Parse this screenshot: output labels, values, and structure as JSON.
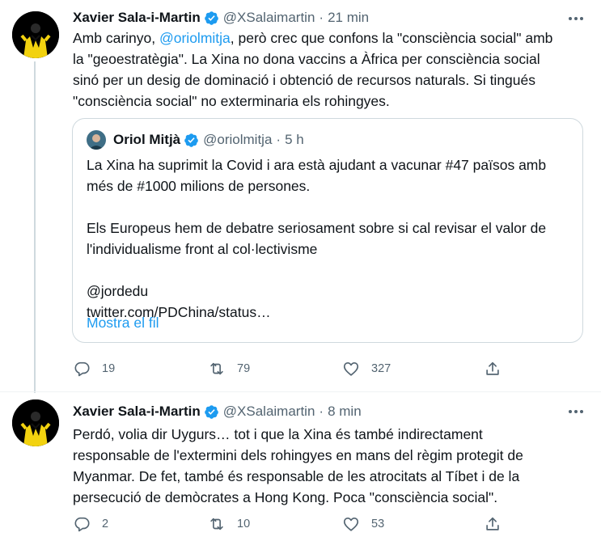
{
  "tweets": [
    {
      "author": {
        "name": "Xavier Sala-i-Martin",
        "handle": "@XSalaimartin",
        "time": "21 min"
      },
      "text_lines": [
        [
          "Amb carinyo, ",
          "@oriolmitja",
          ", però crec que confons la \"consciència social\" amb"
        ],
        "la \"geoestratègia\". La Xina no dona vaccins a Àfrica per consciència social",
        "sinó per un desig de dominació i obtenció de recursos naturals. Si tingués",
        "\"consciència social\" no exterminaria els rohingyes."
      ],
      "quote": {
        "author": {
          "name": "Oriol Mitjà",
          "handle": "@oriolmitja",
          "time": "5 h"
        },
        "lines": [
          "La Xina ha suprimit la Covid i ara està ajudant a vacunar #47 països amb",
          "més de #1000 milions de persones.",
          "",
          "Els Europeus hem de debatre seriosament sobre si cal revisar el valor de",
          "l'individualisme front al col·lectivisme",
          "",
          "@jordedu",
          "twitter.com/PDChina/status…"
        ],
        "show_thread": "Mostra el fil"
      },
      "actions": {
        "replies": "19",
        "retweets": "79",
        "likes": "327"
      }
    },
    {
      "author": {
        "name": "Xavier Sala-i-Martin",
        "handle": "@XSalaimartin",
        "time": "8 min"
      },
      "text_lines": [
        "Perdó, volia dir Uygurs… tot i que la Xina és també indirectament",
        "responsable de l'extermini dels rohingyes en mans del règim protegit de",
        "Myanmar. De fet, també és responsable de les atrocitats al Tíbet i de la",
        "persecució de demòcrates a Hong Kong. Poca \"consciència social\"."
      ],
      "actions": {
        "replies": "2",
        "retweets": "10",
        "likes": "53"
      }
    }
  ],
  "colors": {
    "link": "#1d9bf0",
    "muted": "#536471",
    "border": "#cfd9de",
    "divider": "#eff3f4",
    "avatar_accent": "#f2d20f"
  },
  "icons": [
    "verified-icon",
    "more-icon",
    "reply-icon",
    "retweet-icon",
    "like-icon",
    "share-icon"
  ]
}
